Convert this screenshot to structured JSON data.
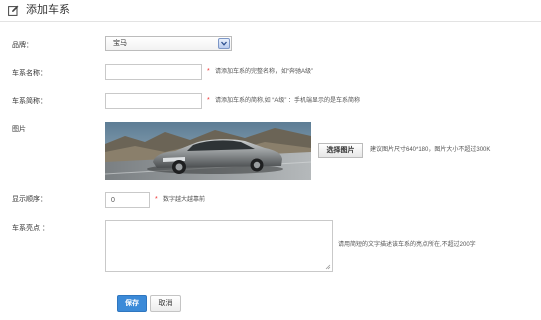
{
  "header": {
    "title": "添加车系",
    "icon": "edit-icon"
  },
  "form": {
    "brand": {
      "label": "品牌：",
      "selected": "宝马"
    },
    "series_name": {
      "label": "车系名称：",
      "value": "",
      "required_mark": "*",
      "hint": "请添加车系的完整名称，如“奔驰A级”"
    },
    "short_name": {
      "label": "车系简称：",
      "value": "",
      "required_mark": "*",
      "hint": "请添加车系的简称,如 “A级” ：手机端显示的是车系简称"
    },
    "image": {
      "label": "图片",
      "choose_button": "选择图片",
      "hint": "建议图片尺寸640*180，图片大小不超过300K"
    },
    "order": {
      "label": "显示顺序：",
      "value": "0",
      "required_mark": "*",
      "hint": "数字越大越靠前"
    },
    "highlights": {
      "label": "车系亮点 ：",
      "value": "",
      "hint": "请用简短的文字描述该车系的亮点所在,不超过200字"
    }
  },
  "actions": {
    "save": "保存",
    "cancel": "取消"
  },
  "colors": {
    "primary": "#3b8ad8",
    "required": "#ee3333"
  }
}
